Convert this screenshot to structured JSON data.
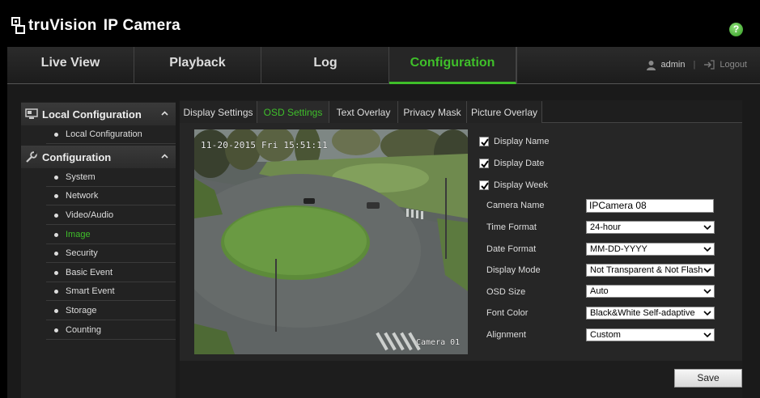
{
  "header": {
    "brand": "truVision",
    "product": "IP Camera",
    "help_icon": "?"
  },
  "topnav": {
    "tabs": [
      {
        "label": "Live View",
        "active": false
      },
      {
        "label": "Playback",
        "active": false
      },
      {
        "label": "Log",
        "active": false
      },
      {
        "label": "Configuration",
        "active": true
      }
    ],
    "user": "admin",
    "logout": "Logout"
  },
  "sidebar": {
    "sections": [
      {
        "title": "Local Configuration",
        "icon": "monitor-icon",
        "items": [
          {
            "label": "Local Configuration",
            "active": false
          }
        ]
      },
      {
        "title": "Configuration",
        "icon": "wrench-icon",
        "items": [
          {
            "label": "System",
            "active": false
          },
          {
            "label": "Network",
            "active": false
          },
          {
            "label": "Video/Audio",
            "active": false
          },
          {
            "label": "Image",
            "active": true
          },
          {
            "label": "Security",
            "active": false
          },
          {
            "label": "Basic Event",
            "active": false
          },
          {
            "label": "Smart Event",
            "active": false
          },
          {
            "label": "Storage",
            "active": false
          },
          {
            "label": "Counting",
            "active": false
          }
        ]
      }
    ]
  },
  "content_tabs": [
    {
      "label": "Display Settings",
      "active": false
    },
    {
      "label": "OSD Settings",
      "active": true
    },
    {
      "label": "Text Overlay",
      "active": false
    },
    {
      "label": "Picture Overlay",
      "active": false
    },
    {
      "label": "Privacy Mask",
      "active": false
    }
  ],
  "preview": {
    "osd_datetime": "11-20-2015 Fri 15:51:11",
    "osd_camera_name": "Camera 01"
  },
  "osd": {
    "display_name": {
      "label": "Display Name",
      "checked": true
    },
    "display_date": {
      "label": "Display Date",
      "checked": true
    },
    "display_week": {
      "label": "Display Week",
      "checked": true
    },
    "camera_name": {
      "label": "Camera Name",
      "value": "IPCamera 08"
    },
    "time_format": {
      "label": "Time Format",
      "value": "24-hour"
    },
    "date_format": {
      "label": "Date Format",
      "value": "MM-DD-YYYY"
    },
    "display_mode": {
      "label": "Display Mode",
      "value": "Not Transparent & Not Flashing"
    },
    "osd_size": {
      "label": "OSD Size",
      "value": "Auto"
    },
    "font_color": {
      "label": "Font Color",
      "value": "Black&White Self-adaptive"
    },
    "alignment": {
      "label": "Alignment",
      "value": "Custom"
    }
  },
  "save_label": "Save",
  "colors": {
    "accent": "#3fbf2a",
    "background": "#000000",
    "panel": "#262626"
  }
}
